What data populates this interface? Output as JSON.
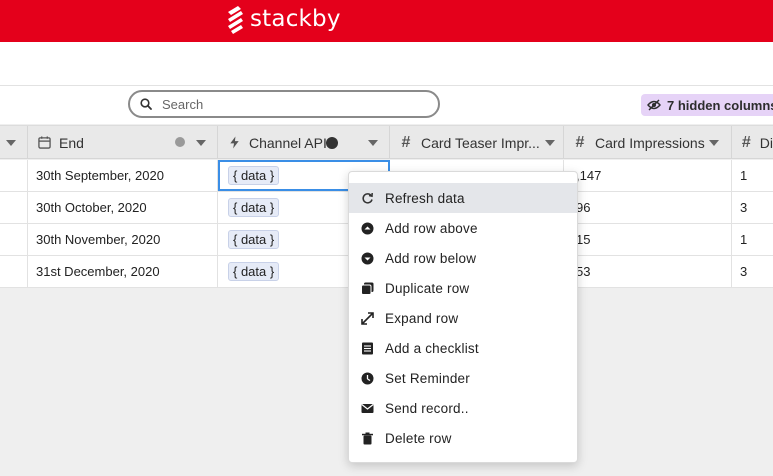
{
  "app": {
    "logo_text": "stackby"
  },
  "toolbar": {
    "search_placeholder": "Search",
    "hidden_columns_label": "7 hidden columns"
  },
  "columns": [
    {
      "label": "",
      "icon": "caret-icon"
    },
    {
      "label": "End",
      "icon": "calendar-icon"
    },
    {
      "label": "Channel API",
      "icon": "bolt-icon"
    },
    {
      "label": "Card Teaser Impr...",
      "icon": "hash-icon"
    },
    {
      "label": "Card Impressions",
      "icon": "hash-icon"
    },
    {
      "label": "Di",
      "icon": "hash-icon"
    }
  ],
  "rows": [
    {
      "end": "30th September, 2020",
      "api": "{ data }",
      "impressions": ",147",
      "di": "1"
    },
    {
      "end": "30th October, 2020",
      "api": "{ data }",
      "impressions": "96",
      "di": "3"
    },
    {
      "end": "30th November, 2020",
      "api": "{ data }",
      "impressions": "15",
      "di": "1"
    },
    {
      "end": "31st December, 2020",
      "api": "{ data }",
      "impressions": "53",
      "di": "3"
    }
  ],
  "context_menu": {
    "items": [
      {
        "label": "Refresh data",
        "icon": "refresh-icon"
      },
      {
        "label": "Add row above",
        "icon": "arrow-up-circle-icon"
      },
      {
        "label": "Add row below",
        "icon": "arrow-down-circle-icon"
      },
      {
        "label": "Duplicate row",
        "icon": "duplicate-icon"
      },
      {
        "label": "Expand row",
        "icon": "expand-icon"
      },
      {
        "label": "Add a checklist",
        "icon": "checklist-icon"
      },
      {
        "label": "Set Reminder",
        "icon": "reminder-icon"
      },
      {
        "label": "Send record..",
        "icon": "envelope-icon"
      },
      {
        "label": "Delete row",
        "icon": "trash-icon"
      }
    ]
  },
  "colors": {
    "brand": "#e4001b",
    "hidden_columns_bg": "#e6d3f7",
    "selection": "#3a8ee6",
    "tag_bg": "#e6ebf7"
  }
}
